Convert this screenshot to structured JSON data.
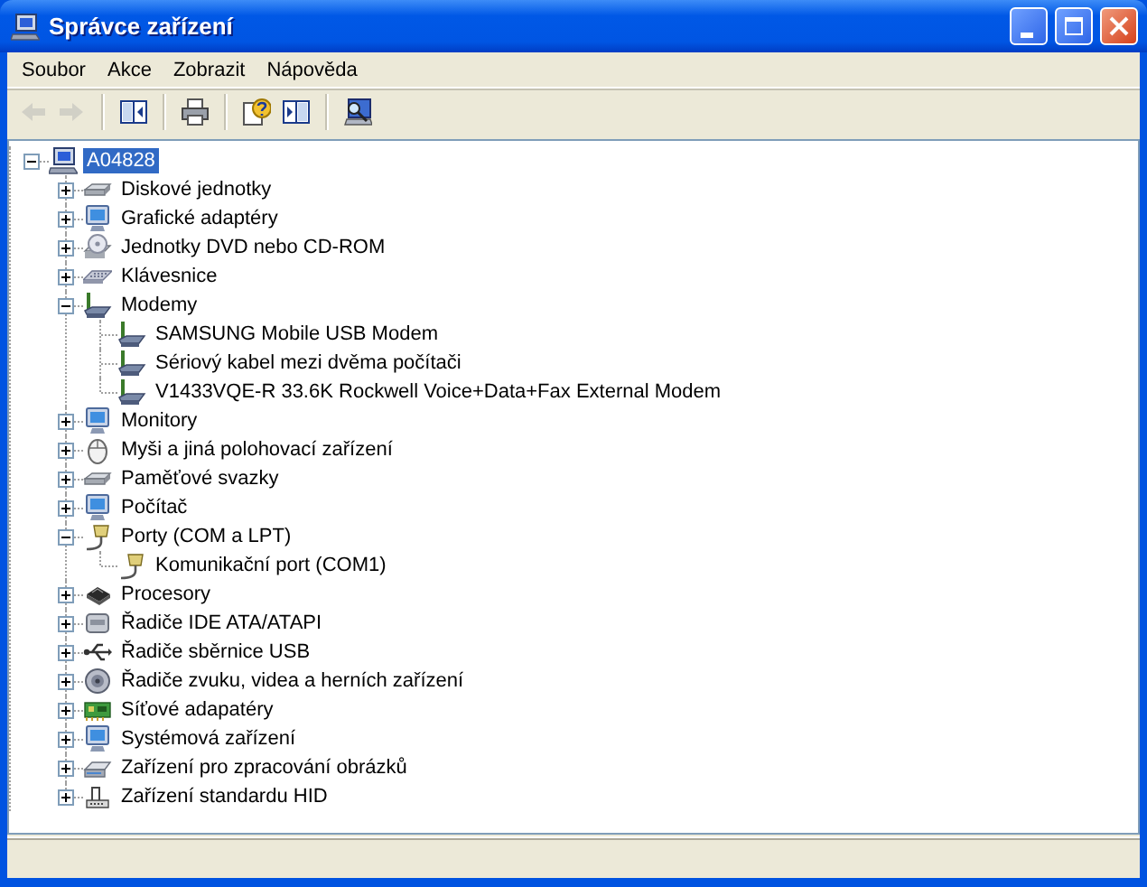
{
  "window": {
    "title": "Správce zařízení"
  },
  "menu": [
    "Soubor",
    "Akce",
    "Zobrazit",
    "Nápověda"
  ],
  "toolbar": [
    {
      "kind": "back",
      "disabled": true
    },
    {
      "kind": "forward",
      "disabled": true
    },
    {
      "kind": "sep"
    },
    {
      "kind": "tree-pane",
      "disabled": false
    },
    {
      "kind": "sep"
    },
    {
      "kind": "print",
      "disabled": false
    },
    {
      "kind": "sep"
    },
    {
      "kind": "help",
      "disabled": false
    },
    {
      "kind": "properties-pane",
      "disabled": false
    },
    {
      "kind": "sep"
    },
    {
      "kind": "scan",
      "disabled": false
    }
  ],
  "tree": {
    "label": "A04828",
    "kind": "computer",
    "selected": true,
    "expanded": true,
    "children": [
      {
        "label": "Diskové jednotky",
        "kind": "disk",
        "selected": false,
        "expanded": false
      },
      {
        "label": "Grafické adaptéry",
        "kind": "display",
        "selected": false,
        "expanded": false
      },
      {
        "label": "Jednotky DVD nebo CD-ROM",
        "kind": "dvd",
        "selected": false,
        "expanded": false
      },
      {
        "label": "Klávesnice",
        "kind": "keyboard",
        "selected": false,
        "expanded": false
      },
      {
        "label": "Modemy",
        "kind": "modem",
        "selected": false,
        "expanded": true,
        "children": [
          {
            "label": "SAMSUNG Mobile USB Modem",
            "kind": "modem",
            "selected": false
          },
          {
            "label": "Sériový kabel mezi dvěma počítači",
            "kind": "modem",
            "selected": false
          },
          {
            "label": "V1433VQE-R 33.6K Rockwell Voice+Data+Fax External Modem",
            "kind": "modem",
            "selected": false
          }
        ]
      },
      {
        "label": "Monitory",
        "kind": "display",
        "selected": false,
        "expanded": false
      },
      {
        "label": "Myši a jiná polohovací zařízení",
        "kind": "mouse",
        "selected": false,
        "expanded": false
      },
      {
        "label": "Paměťové svazky",
        "kind": "disk",
        "selected": false,
        "expanded": false
      },
      {
        "label": "Počítač",
        "kind": "display",
        "selected": false,
        "expanded": false
      },
      {
        "label": "Porty (COM a LPT)",
        "kind": "port",
        "selected": false,
        "expanded": true,
        "children": [
          {
            "label": "Komunikační port (COM1)",
            "kind": "port",
            "selected": false
          }
        ]
      },
      {
        "label": "Procesory",
        "kind": "cpu",
        "selected": false,
        "expanded": false
      },
      {
        "label": "Řadiče IDE ATA/ATAPI",
        "kind": "ide",
        "selected": false,
        "expanded": false
      },
      {
        "label": "Řadiče sběrnice USB",
        "kind": "usb",
        "selected": false,
        "expanded": false
      },
      {
        "label": "Řadiče zvuku, videa a herních zařízení",
        "kind": "sound",
        "selected": false,
        "expanded": false
      },
      {
        "label": "Síťové adapatéry",
        "kind": "network",
        "selected": false,
        "expanded": false
      },
      {
        "label": "Systémová zařízení",
        "kind": "display",
        "selected": false,
        "expanded": false
      },
      {
        "label": "Zařízení pro zpracování obrázků",
        "kind": "imaging",
        "selected": false,
        "expanded": false
      },
      {
        "label": "Zařízení standardu HID",
        "kind": "hid",
        "selected": false,
        "expanded": false
      }
    ]
  }
}
